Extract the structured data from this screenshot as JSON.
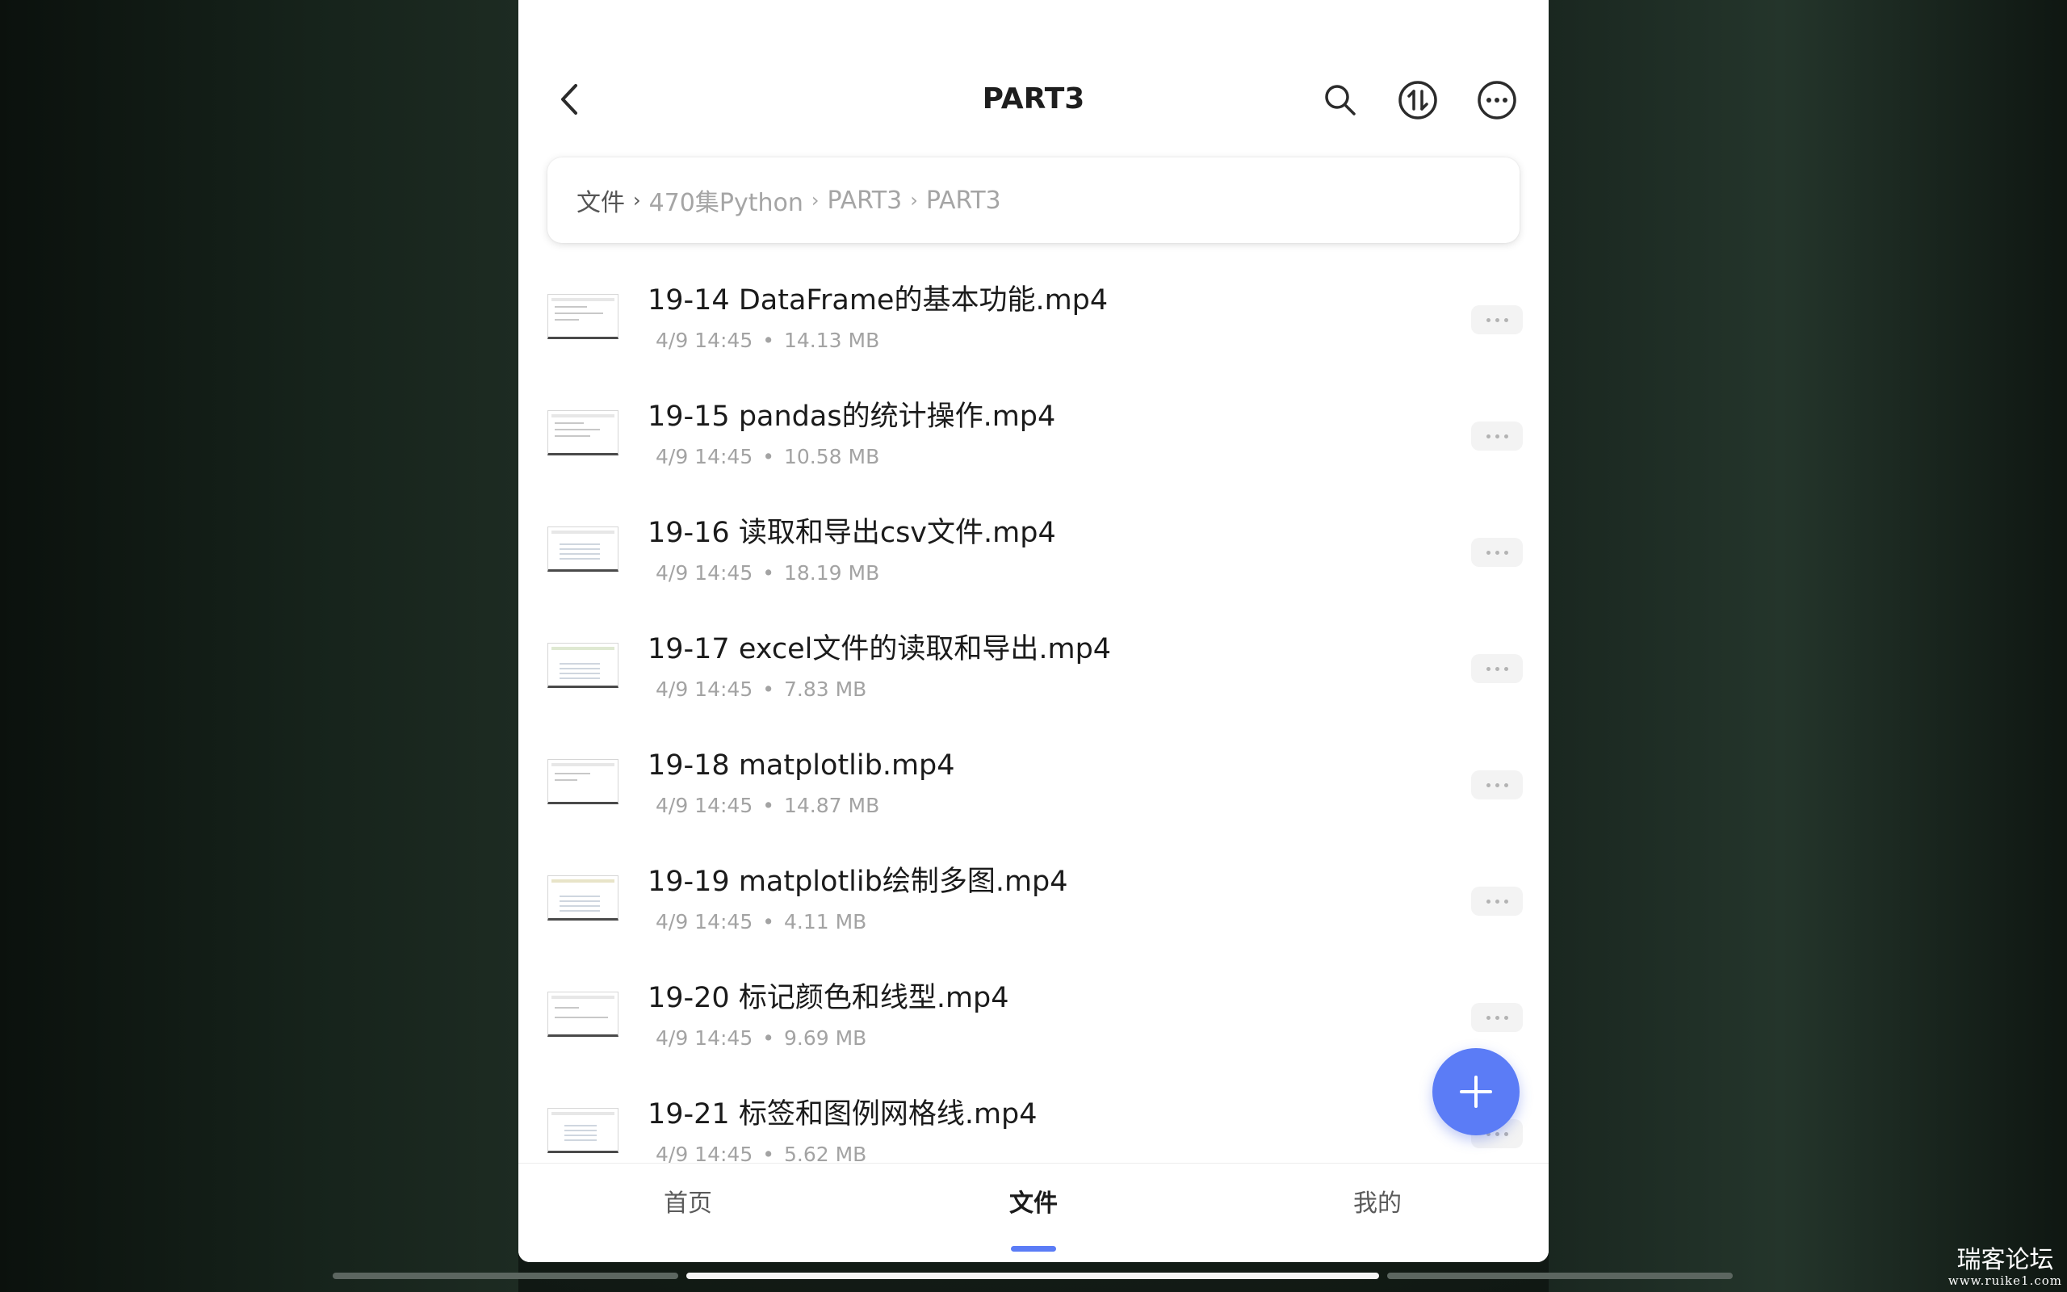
{
  "header": {
    "title": "PART3",
    "back_icon": "chevron-left-icon",
    "search_icon": "search-icon",
    "sort_icon": "sort-arrows-icon",
    "more_icon": "more-horizontal-icon"
  },
  "breadcrumb": {
    "items": [
      "文件",
      "470集Python",
      "PART3",
      "PART3"
    ]
  },
  "files": [
    {
      "name": "19-14 DataFrame的基本功能.mp4",
      "date": "4/9 14:45",
      "size": "14.13 MB"
    },
    {
      "name": "19-15 pandas的统计操作.mp4",
      "date": "4/9 14:45",
      "size": "10.58 MB"
    },
    {
      "name": "19-16 读取和导出csv文件.mp4",
      "date": "4/9 14:45",
      "size": "18.19 MB"
    },
    {
      "name": "19-17 excel文件的读取和导出.mp4",
      "date": "4/9 14:45",
      "size": "7.83 MB"
    },
    {
      "name": "19-18 matplotlib.mp4",
      "date": "4/9 14:45",
      "size": "14.87 MB"
    },
    {
      "name": "19-19 matplotlib绘制多图.mp4",
      "date": "4/9 14:45",
      "size": "4.11 MB"
    },
    {
      "name": "19-20 标记颜色和线型.mp4",
      "date": "4/9 14:45",
      "size": "9.69 MB"
    },
    {
      "name": "19-21 标签和图例网格线.mp4",
      "date": "4/9 14:45",
      "size": "5.62 MB"
    }
  ],
  "meta_separator": "•",
  "fab": {
    "icon": "plus-icon",
    "color": "#5b7cf6"
  },
  "tabs": [
    {
      "label": "首页"
    },
    {
      "label": "文件",
      "active": true
    },
    {
      "label": "我的"
    }
  ],
  "colors": {
    "accent": "#5b7cf6"
  },
  "watermark": {
    "title": "瑞客论坛",
    "url": "www.ruike1.com"
  }
}
